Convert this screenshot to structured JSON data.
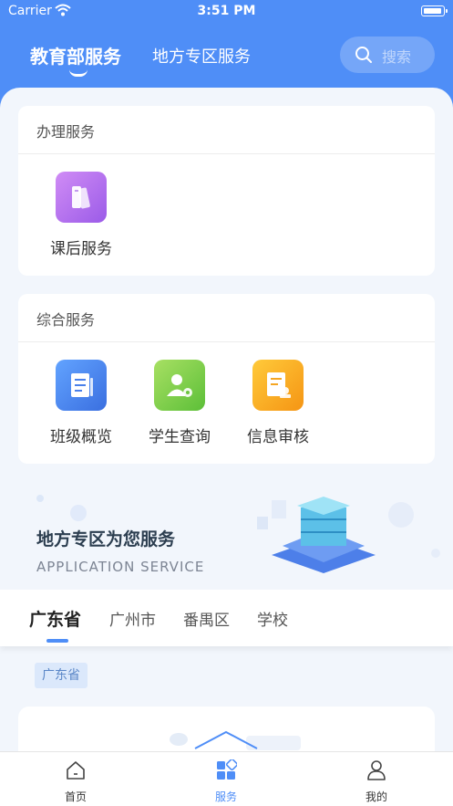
{
  "status_bar": {
    "carrier": "Carrier",
    "time": "3:51 PM"
  },
  "header": {
    "tabs": [
      {
        "label": "教育部服务",
        "active": true
      },
      {
        "label": "地方专区服务",
        "active": false
      }
    ],
    "search_placeholder": "搜索"
  },
  "sections": [
    {
      "title": "办理服务",
      "items": [
        {
          "label": "课后服务",
          "icon": "books-icon"
        }
      ]
    },
    {
      "title": "综合服务",
      "items": [
        {
          "label": "班级概览",
          "icon": "document-icon"
        },
        {
          "label": "学生查询",
          "icon": "student-search-icon"
        },
        {
          "label": "信息审核",
          "icon": "review-stamp-icon"
        }
      ]
    }
  ],
  "banner": {
    "title": "地方专区为您服务",
    "subtitle": "APPLICATION SERVICE"
  },
  "region_tabs": [
    "广东省",
    "广州市",
    "番禺区",
    "学校"
  ],
  "province_tag": "广东省",
  "tabbar": [
    {
      "label": "首页",
      "icon": "home-icon",
      "active": false
    },
    {
      "label": "服务",
      "icon": "services-grid-icon",
      "active": true
    },
    {
      "label": "我的",
      "icon": "profile-icon",
      "active": false
    }
  ],
  "colors": {
    "brand": "#4f8ef7",
    "background": "#f2f6fc"
  }
}
